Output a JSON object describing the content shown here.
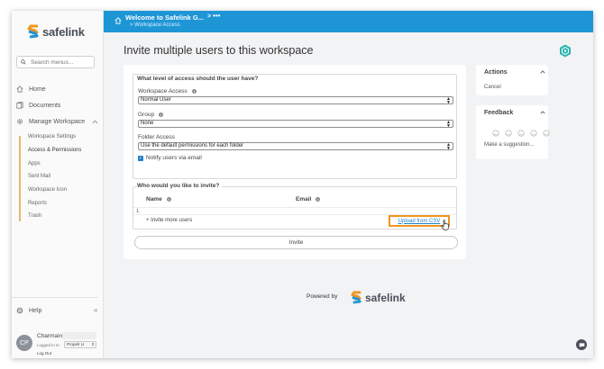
{
  "brand": {
    "name": "safelink",
    "powered_by": "Powered by",
    "accent": "#1e96d6",
    "logo_orange": "#f0961e"
  },
  "sidebar": {
    "search_placeholder": "Search menus...",
    "items": [
      {
        "label": "Home",
        "icon": "home-icon"
      },
      {
        "label": "Documents",
        "icon": "documents-icon"
      },
      {
        "label": "Manage Workspace",
        "icon": "gear-icon"
      }
    ],
    "subitems": [
      {
        "label": "Workspace Settings"
      },
      {
        "label": "Access & Permissions"
      },
      {
        "label": "Apps"
      },
      {
        "label": "Sent Mail"
      },
      {
        "label": "Workspace Icon"
      },
      {
        "label": "Reports"
      },
      {
        "label": "Trash"
      }
    ],
    "help_label": "Help",
    "user": {
      "initials": "CP",
      "name": "Charmaine",
      "logged_in_label": "Logged in to",
      "org": "Propelr Lt",
      "logout": "Log Out"
    }
  },
  "header": {
    "title": "Welcome to Safelink G...",
    "separator": ">",
    "more": "•••",
    "subtitle": "> Workspace Access"
  },
  "page": {
    "title": "Invite multiple users to this workspace"
  },
  "access_form": {
    "section_title": "What level of access should the user have?",
    "workspace_access_label": "Workspace Access",
    "workspace_access_value": "Normal User",
    "group_label": "Group",
    "group_value": "None",
    "folder_access_label": "Folder Access",
    "folder_access_value": "Use the default permissions for each folder",
    "notify_label": "Notify users via email",
    "notify_checked": true
  },
  "invite_form": {
    "section_title": "Who would you like to invite?",
    "name_header": "Name",
    "email_header": "Email",
    "rows": [
      {
        "num": "1."
      }
    ],
    "invite_more": "+ Invite more users",
    "upload_csv": "Upload from CSV",
    "invite_button": "Invite"
  },
  "actions_panel": {
    "title": "Actions",
    "items": [
      "Cancel"
    ]
  },
  "feedback_panel": {
    "title": "Feedback",
    "suggestion": "Make a suggestion..."
  }
}
